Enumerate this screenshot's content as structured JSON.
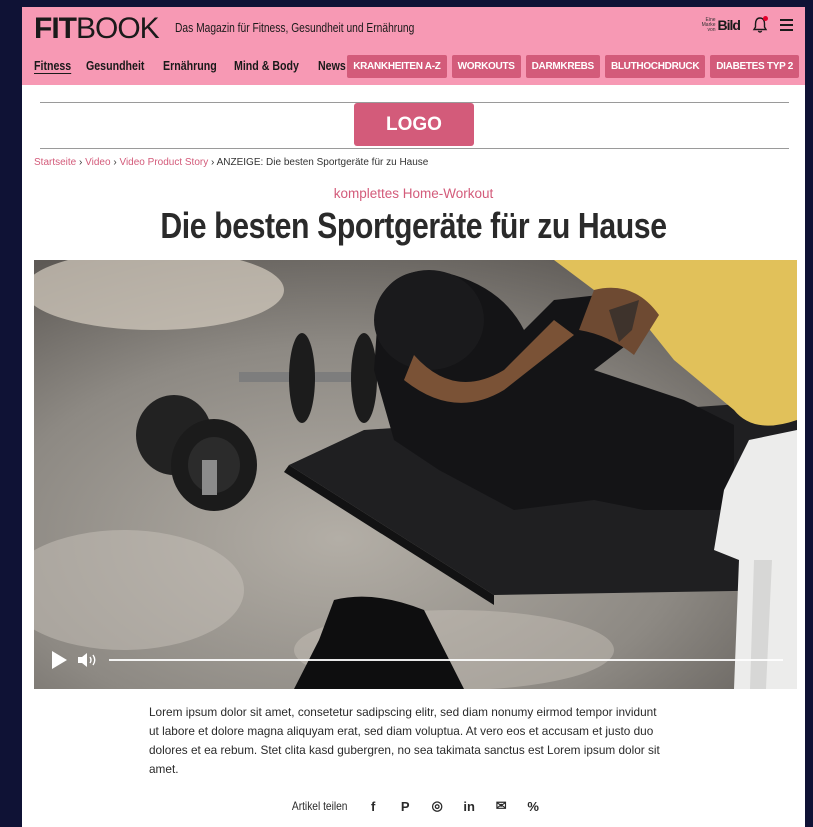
{
  "brand": {
    "part1": "FIT",
    "part2": "BOOK",
    "tagline": "Das Magazin für Fitness, Gesundheit und Ernährung"
  },
  "bild_mark": {
    "small_text": "Eine Marke von",
    "word": "Bild"
  },
  "nav": {
    "items": [
      "Fitness",
      "Gesundheit",
      "Ernährung",
      "Mind & Body",
      "News"
    ],
    "active": "Fitness"
  },
  "topics": [
    "KRANKHEITEN A-Z",
    "WORKOUTS",
    "DARMKREBS",
    "BLUTHOCHDRUCK",
    "DIABETES TYP 2"
  ],
  "logo": {
    "label": "LOGO"
  },
  "breadcrumb": {
    "items": [
      "Startseite",
      "Video",
      "Video Product Story"
    ],
    "separator": "›",
    "current": "ANZEIGE: Die besten Sportgeräte für zu Hause"
  },
  "article": {
    "kicker": "komplettes Home-Workout",
    "headline": "Die besten Sportgeräte für zu Hause",
    "body": "Lorem ipsum dolor sit amet, consetetur sadipscing elitr, sed diam nonumy eirmod tempor invidunt ut labore et dolore magna aliquyam erat, sed diam voluptua. At vero eos et accusam et justo duo dolores et ea rebum. Stet clita kasd gubergren, no sea takimata sanctus est Lorem ipsum dolor sit amet."
  },
  "video": {
    "progress": 0
  },
  "share": {
    "label": "Artikel teilen",
    "icons": [
      "facebook-icon",
      "pinterest-icon",
      "whatsapp-icon",
      "linkedin-icon",
      "mail-icon",
      "link-icon"
    ],
    "glyphs": {
      "facebook": "f",
      "pinterest": "P",
      "whatsapp": "◎",
      "linkedin": "in",
      "mail": "✉",
      "link": "%"
    }
  },
  "colors": {
    "header_bg": "#f799b4",
    "accent": "#d35b7a",
    "page_bg": "#0f1235"
  }
}
